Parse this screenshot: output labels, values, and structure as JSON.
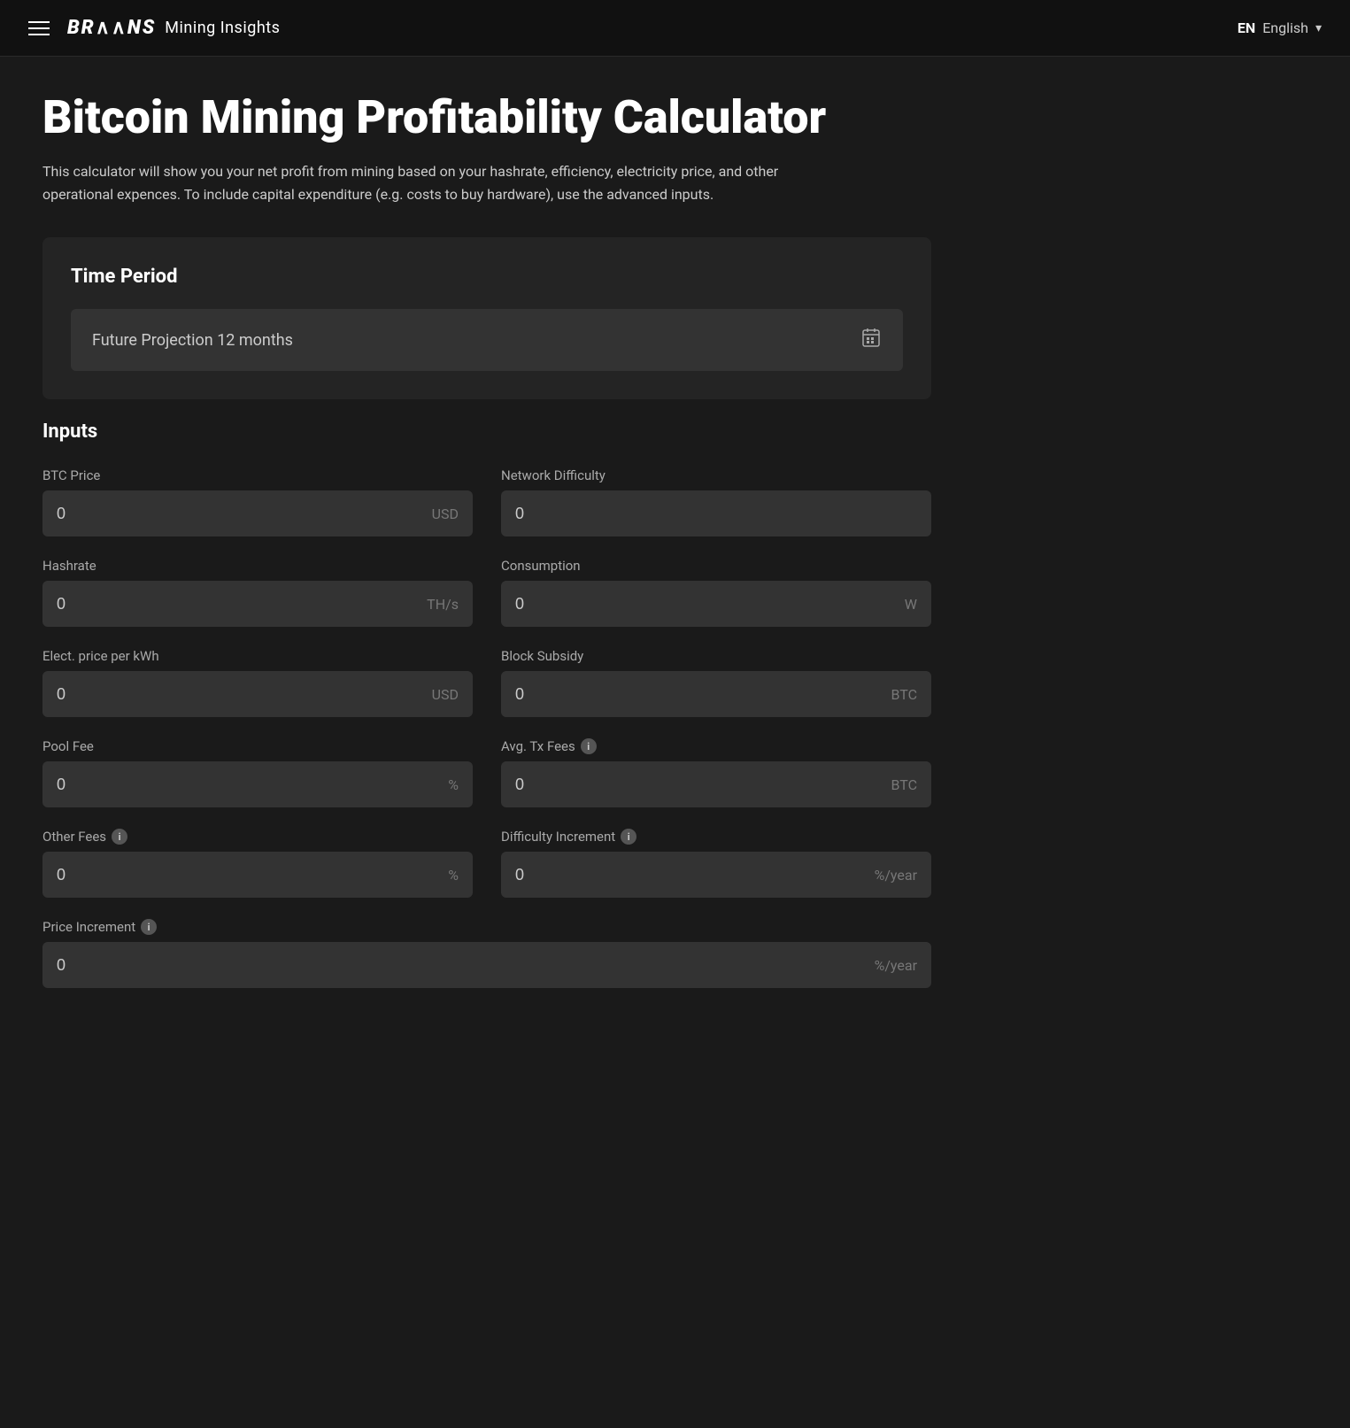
{
  "navbar": {
    "menu_icon": "hamburger-menu",
    "logo_brains": "BR A\\\\NS",
    "logo_subtitle": "Mining Insights",
    "lang_code": "EN",
    "lang_label": "English",
    "chevron": "▾"
  },
  "page": {
    "title": "Bitcoin Mining Profitability Calculator",
    "description": "This calculator will show you your net profit from mining based on your hashrate, efficiency, electricity price, and other operational expences. To include capital expenditure (e.g. costs to buy hardware), use the advanced inputs."
  },
  "time_period": {
    "section_title": "Time Period",
    "selected_value": "Future Projection 12 months",
    "calendar_icon": "📅"
  },
  "inputs": {
    "section_title": "Inputs",
    "fields": [
      {
        "id": "btc-price",
        "label": "BTC Price",
        "value": "0",
        "unit": "USD",
        "has_info": false,
        "full_width": false
      },
      {
        "id": "network-difficulty",
        "label": "Network Difficulty",
        "value": "0",
        "unit": "",
        "has_info": false,
        "full_width": false
      },
      {
        "id": "hashrate",
        "label": "Hashrate",
        "value": "0",
        "unit": "TH/s",
        "has_info": false,
        "full_width": false
      },
      {
        "id": "consumption",
        "label": "Consumption",
        "value": "0",
        "unit": "W",
        "has_info": false,
        "full_width": false
      },
      {
        "id": "elect-price",
        "label": "Elect. price per kWh",
        "value": "0",
        "unit": "USD",
        "has_info": false,
        "full_width": false
      },
      {
        "id": "block-subsidy",
        "label": "Block Subsidy",
        "value": "0",
        "unit": "BTC",
        "has_info": false,
        "full_width": false
      },
      {
        "id": "pool-fee",
        "label": "Pool Fee",
        "value": "0",
        "unit": "%",
        "has_info": false,
        "full_width": false
      },
      {
        "id": "avg-tx-fees",
        "label": "Avg. Tx Fees",
        "value": "0",
        "unit": "BTC",
        "has_info": true,
        "full_width": false
      },
      {
        "id": "other-fees",
        "label": "Other Fees",
        "value": "0",
        "unit": "%",
        "has_info": true,
        "full_width": false
      },
      {
        "id": "difficulty-increment",
        "label": "Difficulty Increment",
        "value": "0",
        "unit": "%/year",
        "has_info": true,
        "full_width": false
      },
      {
        "id": "price-increment",
        "label": "Price Increment",
        "value": "0",
        "unit": "%/year",
        "has_info": true,
        "full_width": true
      }
    ],
    "info_label": "i"
  }
}
